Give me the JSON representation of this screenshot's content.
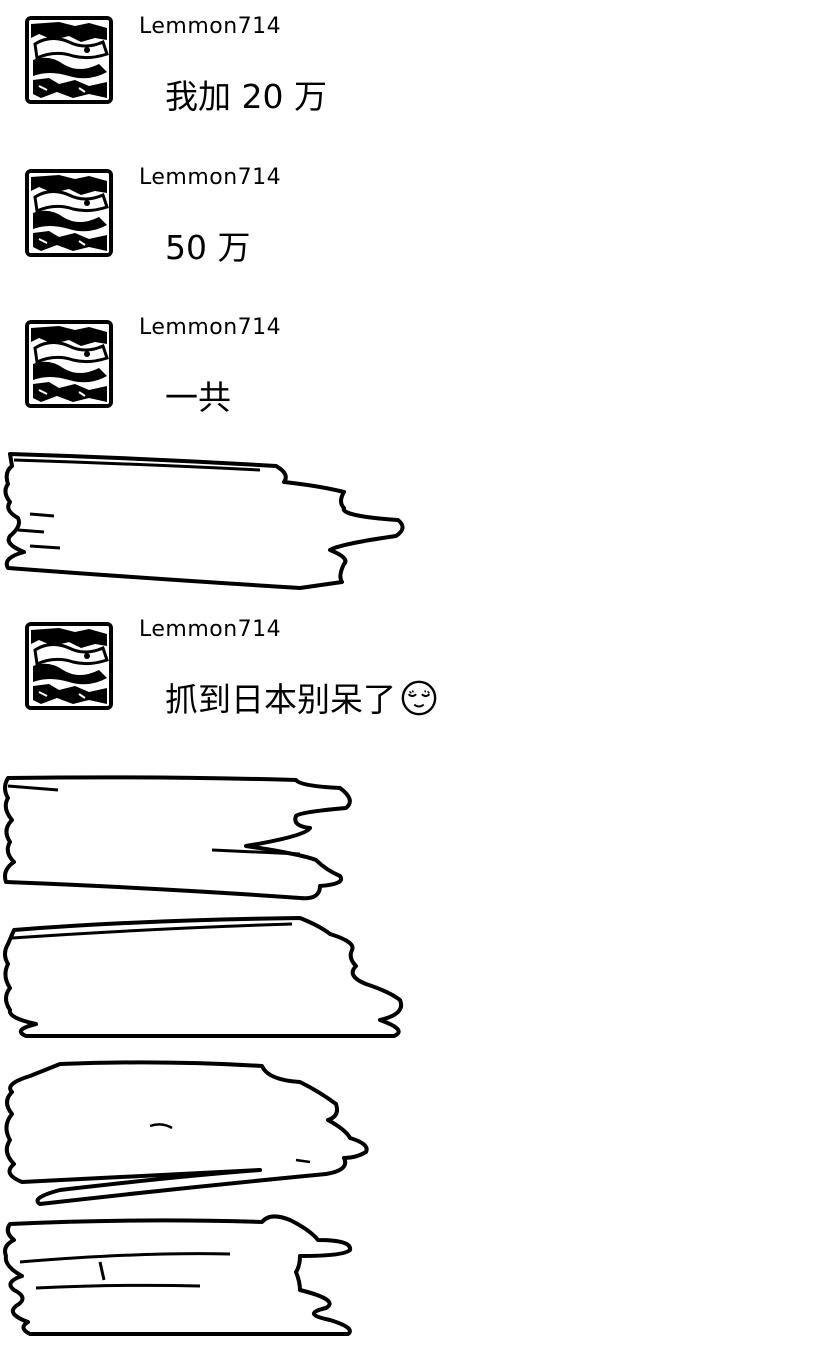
{
  "messages": [
    {
      "sender": "Lemmon714",
      "text": "我加 20 万"
    },
    {
      "sender": "Lemmon714",
      "text": "50 万"
    },
    {
      "sender": "Lemmon714",
      "text": "一共"
    },
    {
      "sender": "Lemmon714",
      "text": "抓到日本别呆了",
      "emoji": "relieved-face-icon"
    }
  ],
  "redactions": [
    "scribble-redaction",
    "scribble-redaction",
    "scribble-redaction",
    "scribble-redaction",
    "scribble-redaction"
  ]
}
